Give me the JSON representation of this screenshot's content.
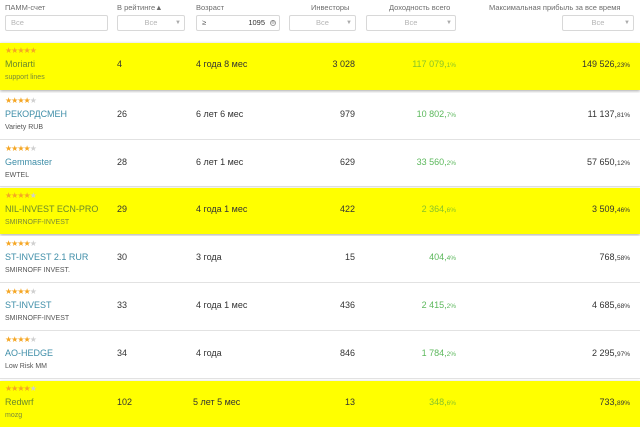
{
  "header": {
    "col_account": "ПАММ-счет",
    "col_rating": "В рейтинге▲",
    "col_age": "Возраст",
    "col_investors": "Инвесторы",
    "col_yield": "Доходность всего",
    "col_maxprofit": "Максимальная прибыль за все время"
  },
  "filters": {
    "account_placeholder": "Все",
    "rating_placeholder": "Все",
    "age_operator": "≥",
    "age_value": "1095",
    "investors_placeholder": "Все",
    "yield_placeholder": "Все",
    "maxprofit_placeholder": "Все"
  },
  "colors": {
    "highlight": "#ffff00",
    "star": "#f5a623",
    "yield_green": "#5cb85c",
    "link": "#3f8ea8"
  },
  "rows": [
    {
      "stars": 5,
      "name": "Moriarti",
      "manager": "support lines",
      "rating": "4",
      "age": "4 года 8 мес",
      "investors": "3 028",
      "yield_main": "117 079,",
      "yield_dec": "1%",
      "max_main": "149 526,",
      "max_dec": "23%",
      "highlight": true
    },
    {
      "stars": 4,
      "name": "РЕКОРДСМЕН",
      "manager": "Variety RUB",
      "rating": "26",
      "age": "6 лет 6 мес",
      "investors": "979",
      "yield_main": "10 802,",
      "yield_dec": "7%",
      "max_main": "11 137,",
      "max_dec": "81%",
      "highlight": false
    },
    {
      "stars": 4,
      "name": "Gemmaster",
      "manager": "EWTEL",
      "rating": "28",
      "age": "6 лет 1 мес",
      "investors": "629",
      "yield_main": "33 560,",
      "yield_dec": "2%",
      "max_main": "57 650,",
      "max_dec": "12%",
      "highlight": false
    },
    {
      "stars": 4,
      "name": "NIL-INVEST ECN-PRO",
      "manager": "SMIRNOFF-INVEST",
      "rating": "29",
      "age": "4 года 1 мес",
      "investors": "422",
      "yield_main": "2 364,",
      "yield_dec": "6%",
      "max_main": "3 509,",
      "max_dec": "46%",
      "highlight": true
    },
    {
      "stars": 4,
      "name": "ST-INVEST 2.1 RUR",
      "manager": "SMIRNOFF INVEST.",
      "rating": "30",
      "age": "3 года",
      "investors": "15",
      "yield_main": "404,",
      "yield_dec": "4%",
      "max_main": "768,",
      "max_dec": "58%",
      "highlight": false
    },
    {
      "stars": 4,
      "name": "ST-INVEST",
      "manager": "SMIRNOFF-INVEST",
      "rating": "33",
      "age": "4 года 1 мес",
      "investors": "436",
      "yield_main": "2 415,",
      "yield_dec": "2%",
      "max_main": "4 685,",
      "max_dec": "68%",
      "highlight": false
    },
    {
      "stars": 4,
      "name": "AO-HEDGE",
      "manager": "Low Risk MM",
      "rating": "34",
      "age": "4 года",
      "investors": "846",
      "yield_main": "1 784,",
      "yield_dec": "2%",
      "max_main": "2 295,",
      "max_dec": "97%",
      "highlight": false
    },
    {
      "stars": 4,
      "name": "Redwrf",
      "manager": "mozg",
      "rating": "102",
      "age": "5 лет 5 мес",
      "investors": "13",
      "yield_main": "348,",
      "yield_dec": "6%",
      "max_main": "733,",
      "max_dec": "89%",
      "highlight": true
    }
  ]
}
